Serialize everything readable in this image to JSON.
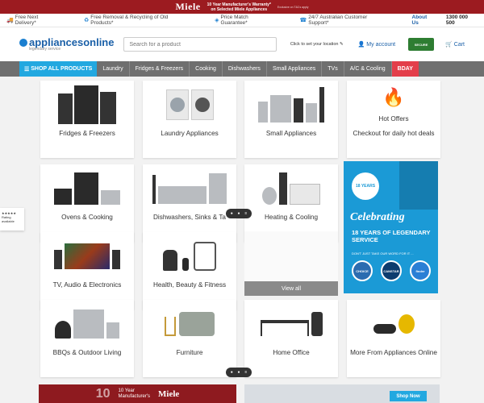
{
  "promo_banner": {
    "brand": "Miele",
    "line1": "10 Year Manufacturer's Warranty*",
    "line2": "on Selected Miele Appliances",
    "tc": "Exclusive on T&Cs apply"
  },
  "usp_bar": {
    "items": [
      {
        "icon": "truck-icon",
        "label": "Free Next Delivery*"
      },
      {
        "icon": "recycle-icon",
        "label": "Free Removal & Recycling of Old Products*"
      },
      {
        "icon": "tag-icon",
        "label": "Price Match Guarantee*"
      },
      {
        "icon": "headset-icon",
        "label": "24/7 Australian Customer Support*"
      }
    ],
    "about": "About Us",
    "phone": "1300 000 500"
  },
  "header": {
    "brand_name": "appliancesonline",
    "brand_tagline": "legendary service",
    "search_placeholder": "Search for a product",
    "location": "Click to set your location",
    "account": "My account",
    "secure_badge": "SECURE",
    "cart": "Cart"
  },
  "nav": {
    "shop_all": "SHOP ALL PRODUCTS",
    "items": [
      "Laundry",
      "Fridges & Freezers",
      "Cooking",
      "Dishwashers",
      "Small Appliances",
      "TVs",
      "A/C & Cooling"
    ],
    "bday": "BDAY"
  },
  "categories": [
    {
      "label": "Fridges & Freezers"
    },
    {
      "label": "Laundry Appliances"
    },
    {
      "label": "Small Appliances"
    },
    {
      "label": "Hot Offers",
      "sub": "Checkout for daily hot deals"
    },
    {
      "label": "Ovens & Cooking"
    },
    {
      "label": "Dishwashers, Sinks & Ta"
    },
    {
      "label": "Heating & Cooling"
    },
    {
      "label": "TV, Audio & Electronics"
    },
    {
      "label": "Health, Beauty & Fitness"
    },
    {
      "label": "BBQs & Outdoor Living"
    },
    {
      "label": "Furniture"
    },
    {
      "label": "Home Office"
    },
    {
      "label": "More From Appliances Online"
    }
  ],
  "view_all": "View all",
  "promo_tile": {
    "years_badge": "18 YEARS",
    "headline": "Celebrating",
    "sub": "18 YEARS OF LEGENDARY SERVICE",
    "note": "DON'T JUST TAKE OUR WORD FOR IT ...",
    "badges": [
      "CHOICE",
      "CANSTAR",
      "finder"
    ]
  },
  "side_widget": {
    "stars": "★★★★★",
    "text": "Rating available"
  },
  "bottom_banner": {
    "line1": "10 Year",
    "line2": "Manufacturer's",
    "brand": "Miele",
    "shop_now": "Shop Now"
  },
  "colors": {
    "accent": "#22a8e0",
    "brand_blue": "#1b60a8",
    "promo_red": "#9c1b20",
    "bday": "#e33e4a",
    "nav_gray": "#6f6f6f"
  }
}
